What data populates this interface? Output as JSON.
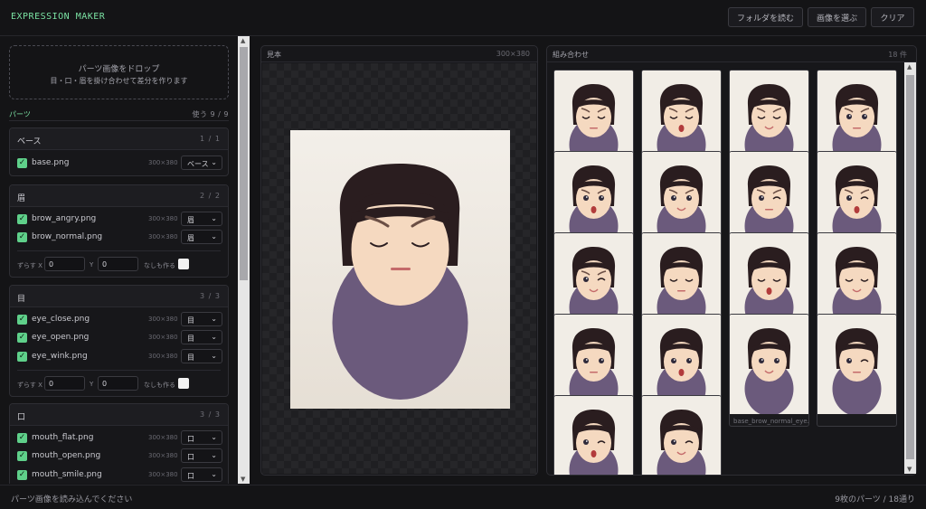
{
  "header": {
    "title": "EXPRESSION MAKER",
    "buttons": {
      "folder": "フォルダを読む",
      "select": "画像を選ぶ",
      "clear": "クリア"
    }
  },
  "dropzone": {
    "title": "パーツ画像をドロップ",
    "subtitle": "目・口・眉を掛け合わせて差分を作ります"
  },
  "parts": {
    "label": "パーツ",
    "used": "使う 9 / 9",
    "offset_x_label": "ずらす X",
    "offset_y_label": "Y",
    "none_label": "なしも作る",
    "groups": [
      {
        "name": "ベース",
        "count": "1 / 1",
        "items": [
          {
            "file": "base.png",
            "size": "300×380",
            "category": "ベース",
            "checked": true
          }
        ]
      },
      {
        "name": "眉",
        "count": "2 / 2",
        "items": [
          {
            "file": "brow_angry.png",
            "size": "300×380",
            "category": "眉",
            "checked": true
          },
          {
            "file": "brow_normal.png",
            "size": "300×380",
            "category": "眉",
            "checked": true
          }
        ],
        "offset_x": "0",
        "offset_y": "0"
      },
      {
        "name": "目",
        "count": "3 / 3",
        "items": [
          {
            "file": "eye_close.png",
            "size": "300×380",
            "category": "目",
            "checked": true
          },
          {
            "file": "eye_open.png",
            "size": "300×380",
            "category": "目",
            "checked": true
          },
          {
            "file": "eye_wink.png",
            "size": "300×380",
            "category": "目",
            "checked": true
          }
        ],
        "offset_x": "0",
        "offset_y": "0"
      },
      {
        "name": "口",
        "count": "3 / 3",
        "items": [
          {
            "file": "mouth_flat.png",
            "size": "300×380",
            "category": "口",
            "checked": true
          },
          {
            "file": "mouth_open.png",
            "size": "300×380",
            "category": "口",
            "checked": true
          },
          {
            "file": "mouth_smile.png",
            "size": "300×380",
            "category": "口",
            "checked": true
          }
        ]
      }
    ]
  },
  "preview": {
    "title": "見本",
    "size": "300×380"
  },
  "combos": {
    "title": "組み合わせ",
    "count": "18 件",
    "cards": [
      {
        "eye": "close",
        "mouth": "flat",
        "brow": true
      },
      {
        "eye": "close",
        "mouth": "open",
        "brow": true
      },
      {
        "eye": "close",
        "mouth": "smile",
        "brow": true
      },
      {
        "eye": "open",
        "mouth": "flat",
        "brow": true
      },
      {
        "eye": "open",
        "mouth": "open",
        "brow": true
      },
      {
        "eye": "open",
        "mouth": "smile",
        "brow": true
      },
      {
        "eye": "wink",
        "mouth": "flat",
        "brow": true
      },
      {
        "eye": "wink",
        "mouth": "open",
        "brow": true
      },
      {
        "eye": "wink",
        "mouth": "smile",
        "brow": true
      },
      {
        "eye": "close",
        "mouth": "flat",
        "brow": false
      },
      {
        "eye": "close",
        "mouth": "open",
        "brow": false
      },
      {
        "eye": "close",
        "mouth": "smile",
        "brow": false
      },
      {
        "eye": "open",
        "mouth": "flat",
        "brow": false
      },
      {
        "eye": "open",
        "mouth": "open",
        "brow": false,
        "caption": "base_brow_normal_eye..."
      },
      {
        "eye": "open",
        "mouth": "smile",
        "brow": false,
        "caption": "base_brow_normal_eye..."
      },
      {
        "eye": "wink",
        "mouth": "flat",
        "brow": false
      },
      {
        "eye": "wink",
        "mouth": "open",
        "brow": false
      },
      {
        "eye": "wink",
        "mouth": "smile",
        "brow": false
      }
    ]
  },
  "footer": {
    "status": "パーツ画像を読み込んでください",
    "summary": "9枚のパーツ / 18通り"
  },
  "colors": {
    "accent": "#7be3a4",
    "hair": "#2a1d1f",
    "body": "#6b5a7c",
    "skin": "#f5d9c0",
    "paper": "#f1ede6"
  }
}
